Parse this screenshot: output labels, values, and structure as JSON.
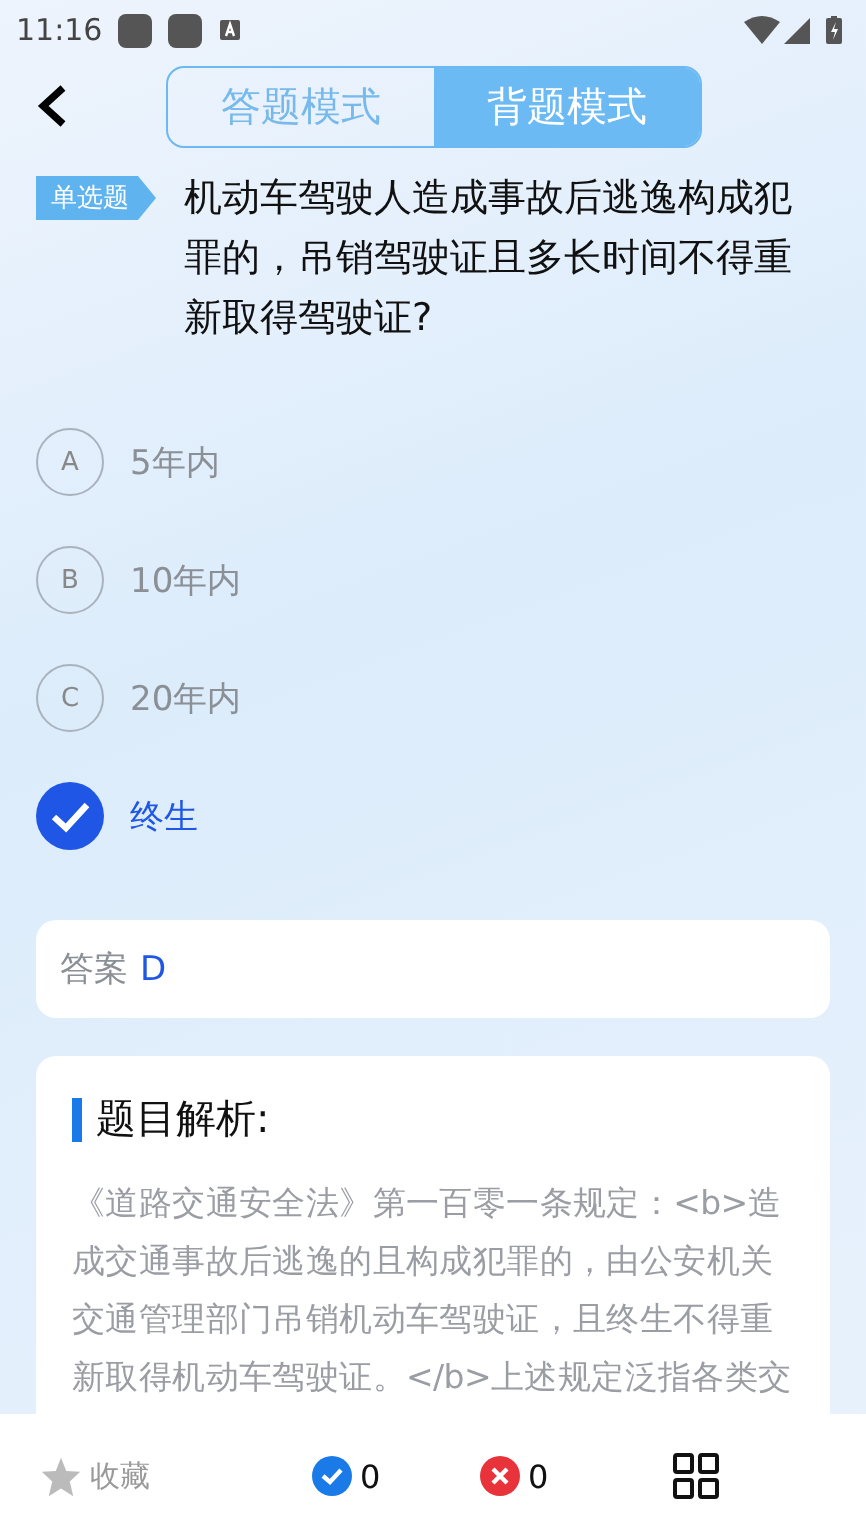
{
  "status_bar": {
    "time": "11:16"
  },
  "mode_tabs": [
    {
      "label": "答题模式",
      "selected": false
    },
    {
      "label": "背题模式",
      "selected": true
    }
  ],
  "question": {
    "type_tag": "单选题",
    "text": "机动车驾驶人造成事故后逃逸构成犯罪的，吊销驾驶证且多长时间不得重新取得驾驶证?"
  },
  "options": [
    {
      "letter": "A",
      "text": "5年内",
      "selected": false
    },
    {
      "letter": "B",
      "text": "10年内",
      "selected": false
    },
    {
      "letter": "C",
      "text": "20年内",
      "selected": false
    },
    {
      "text": "终生",
      "selected": true
    }
  ],
  "answer": {
    "label": "答案",
    "value": "D"
  },
  "explanation": {
    "title": "题目解析:",
    "text": "《道路交通安全法》第一百零一条规定：<b>造成交通事故后逃逸的且构成犯罪的，由公安机关交通管理部门吊销机动车驾驶证，且终生不得重新取得机动车驾驶证。</b>上述规定泛指各类交"
  },
  "bottom_bar": {
    "favorite_label": "收藏",
    "correct_count": "0",
    "wrong_count": "0"
  }
}
